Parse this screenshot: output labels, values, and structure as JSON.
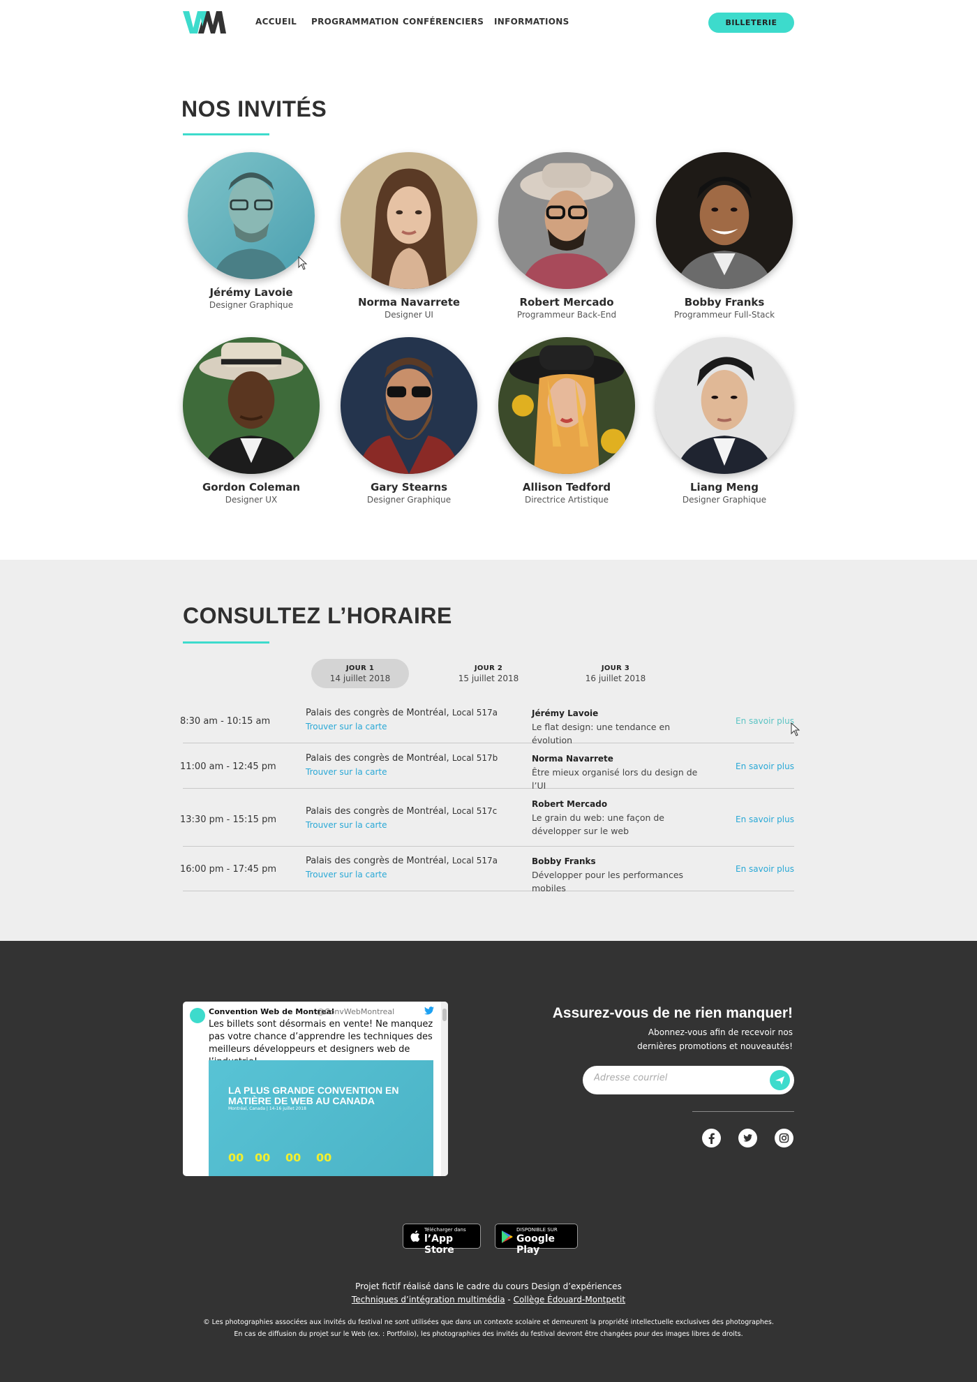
{
  "nav": {
    "logo_alt": "WM",
    "links": [
      "ACCUEIL",
      "PROGRAMMATION",
      "CONFÉRENCIERS",
      "INFORMATIONS"
    ],
    "ticket_button": "BILLETERIE"
  },
  "guests": {
    "title": "NOS INVITÉS",
    "items": [
      {
        "name": "Jérémy Lavoie",
        "role": "Designer Graphique"
      },
      {
        "name": "Norma Navarrete",
        "role": "Designer UI"
      },
      {
        "name": "Robert Mercado",
        "role": "Programmeur Back-End"
      },
      {
        "name": "Bobby Franks",
        "role": "Programmeur Full-Stack"
      },
      {
        "name": "Gordon Coleman",
        "role": "Designer UX"
      },
      {
        "name": "Gary Stearns",
        "role": "Designer Graphique"
      },
      {
        "name": "Allison Tedford",
        "role": "Directrice Artistique"
      },
      {
        "name": "Liang Meng",
        "role": "Designer Graphique"
      }
    ]
  },
  "schedule": {
    "title": "CONSULTEZ L’HORAIRE",
    "days": [
      {
        "label": "JOUR 1",
        "date": "14 juillet 2018",
        "active": true
      },
      {
        "label": "JOUR 2",
        "date": "15 juillet 2018",
        "active": false
      },
      {
        "label": "JOUR 3",
        "date": "16 juillet 2018",
        "active": false
      }
    ],
    "map_link": "Trouver sur la carte",
    "more_link": "En savoir plus",
    "rows": [
      {
        "time": "8:30 am - 10:15 am",
        "place": "Palais des congrès de Montréal,",
        "room": "Local 517a",
        "speaker": "Jérémy Lavoie",
        "talk": "Le flat design: une tendance en évolution"
      },
      {
        "time": "11:00 am - 12:45 pm",
        "place": "Palais des congrès de Montréal,",
        "room": "Local 517b",
        "speaker": "Norma Navarrete",
        "talk": "Être mieux organisé lors du design de l’UI"
      },
      {
        "time": "13:30 pm - 15:15 pm",
        "place": "Palais des congrès de Montréal,",
        "room": "Local 517c",
        "speaker": "Robert Mercado",
        "talk": "Le grain du web: une façon de développer sur le web"
      },
      {
        "time": "16:00 pm - 17:45 pm",
        "place": "Palais des congrès de Montréal,",
        "room": "Local 517a",
        "speaker": "Bobby Franks",
        "talk": "Développer pour les performances mobiles"
      }
    ]
  },
  "tweet": {
    "name": "Convention Web de Montreal",
    "handle": "@ConvWebMontreal",
    "text": "Les billets sont désormais en vente! Ne manquez pas votre chance d’apprendre les techniques des meilleurs développeurs et designers web de l’industrie!",
    "image_title": "LA PLUS GRANDE CONVENTION EN MATIÈRE DE WEB AU CANADA",
    "image_subtitle": "Montréal, Canada | 14-16 juillet 2018",
    "countdown": [
      "00",
      "00",
      "00",
      "00"
    ]
  },
  "newsletter": {
    "title": "Assurez-vous de ne rien manquer!",
    "subtitle": "Abonnez-vous afin de recevoir nos dernières promotions et nouveautés!",
    "placeholder": "Adresse courriel"
  },
  "social": [
    "facebook-icon",
    "twitter-icon",
    "instagram-icon"
  ],
  "stores": {
    "apple_small": "Télécharger dans",
    "apple_big": "l’App Store",
    "google_small": "DISPONIBLE SUR",
    "google_big": "Google Play"
  },
  "credits": {
    "line1": "Projet fictif réalisé dans le cadre du cours Design d’expériences",
    "link1": "Techniques d’intégration multimédia",
    "sep": " - ",
    "link2": "Collège Édouard-Montpetit",
    "line3": "© Les photographies associées aux invités du festival ne sont utilisées que dans un contexte scolaire et demeurent la propriété intellectuelle exclusives des photographes.",
    "line4": "En cas de diffusion du projet sur le Web (ex. : Portfolio), les photographies des invités du festival devront être changées pour des images libres de droits."
  },
  "colors": {
    "accent": "#3ddbcc",
    "link": "#29a8d6",
    "footer_bg": "#333333",
    "schedule_bg": "#eeeeee"
  }
}
